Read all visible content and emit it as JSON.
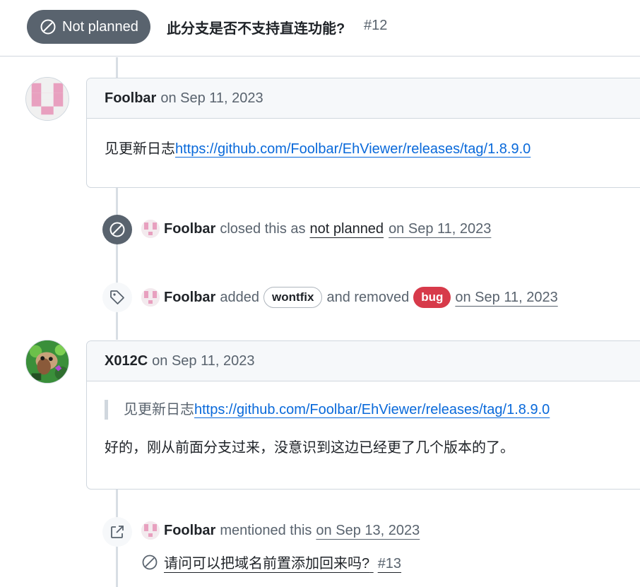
{
  "issue": {
    "state_label": "Not planned",
    "title": "此分支是否不支持直连功能?",
    "number": "#12"
  },
  "comments": [
    {
      "author": "Foolbar",
      "date": "on Sep 11, 2023",
      "body_text": "见更新日志",
      "body_link": "https://github.com/Foolbar/EhViewer/releases/tag/1.8.9.0"
    },
    {
      "author": "X012C",
      "date": "on Sep 11, 2023",
      "quote_text": "见更新日志",
      "quote_link": "https://github.com/Foolbar/EhViewer/releases/tag/1.8.9.0",
      "body_text": "好的，刚从前面分支过来，没意识到这边已经更了几个版本的了。"
    }
  ],
  "events": {
    "closed": {
      "actor": "Foolbar",
      "text": "closed this as",
      "reason": "not planned",
      "date": "on Sep 11, 2023"
    },
    "labeled": {
      "actor": "Foolbar",
      "added_text": "added",
      "added_label": "wontfix",
      "removed_text": "and removed",
      "removed_label": "bug",
      "date": "on Sep 11, 2023"
    },
    "mentioned": {
      "actor": "Foolbar",
      "text": "mentioned this",
      "date": "on Sep 13, 2023",
      "ref_title": "请问可以把域名前置添加回来吗?",
      "ref_number": "#13"
    }
  },
  "colors": {
    "not_planned_badge": "#59636e",
    "bug_label": "#d73a4a",
    "link": "#0969da"
  },
  "icons": {
    "state": "skip-icon",
    "closed_event": "skip-icon",
    "labeled_event": "tag-icon",
    "mentioned_event": "cross-reference-icon"
  }
}
